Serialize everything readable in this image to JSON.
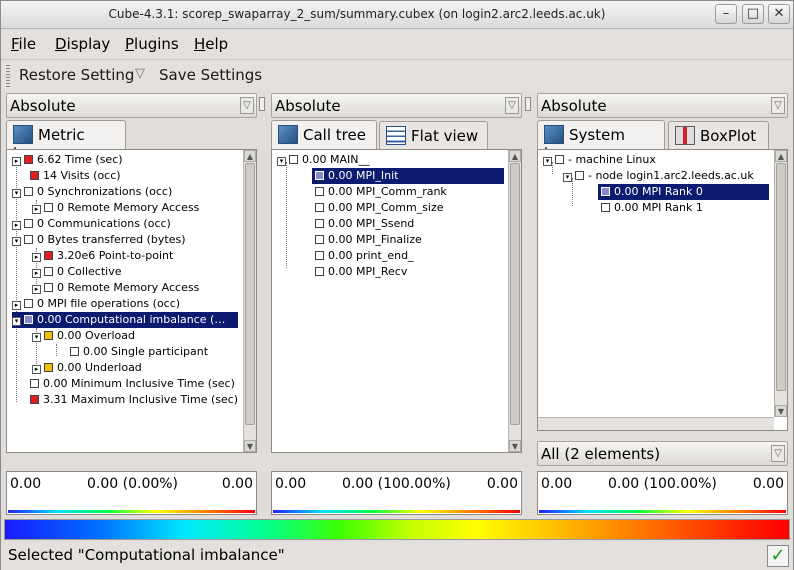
{
  "window": {
    "title": "Cube-4.3.1: scorep_swaparray_2_sum/summary.cubex (on login2.arc2.leeds.ac.uk)",
    "btn_min": "–",
    "btn_max": "□",
    "btn_close": "✕"
  },
  "menu": {
    "file": "F",
    "file_rest": "ile",
    "display": "D",
    "display_rest": "isplay",
    "plugins": "P",
    "plugins_rest": "lugins",
    "help": "H",
    "help_rest": "elp"
  },
  "toolbar": {
    "restore": "Restore Setting",
    "save": "Save Settings"
  },
  "metric_pane": {
    "mode": "Absolute",
    "tab": "Metric tree",
    "rows": [
      {
        "label": "6.62 Time (sec)",
        "color": "#e02020"
      },
      {
        "label": "14 Visits (occ)",
        "color": "#e02020"
      },
      {
        "label": "0 Synchronizations (occ)",
        "color": "#ffffff"
      },
      {
        "label": "0 Remote Memory Access",
        "color": "#ffffff"
      },
      {
        "label": "0 Communications (occ)",
        "color": "#ffffff"
      },
      {
        "label": "0 Bytes transferred (bytes)",
        "color": "#ffffff"
      },
      {
        "label": "3.20e6 Point-to-point",
        "color": "#e02020"
      },
      {
        "label": "0 Collective",
        "color": "#ffffff"
      },
      {
        "label": "0 Remote Memory Access",
        "color": "#ffffff"
      },
      {
        "label": "0 MPI file operations (occ)",
        "color": "#ffffff"
      },
      {
        "label": "0.00 Computational imbalance (…",
        "color": "#8a8ac8"
      },
      {
        "label": "0.00 Overload",
        "color": "#f0c000"
      },
      {
        "label": "0.00 Single participant",
        "color": "#ffffff"
      },
      {
        "label": "0.00 Underload",
        "color": "#f0c000"
      },
      {
        "label": "0.00 Minimum Inclusive Time (sec)",
        "color": "#ffffff"
      },
      {
        "label": "3.31 Maximum Inclusive Time (sec)",
        "color": "#e02020"
      }
    ],
    "value_left": "0.00",
    "value_mid": "0.00 (0.00%)",
    "value_right": "0.00"
  },
  "call_pane": {
    "mode": "Absolute",
    "tab1": "Call tree",
    "tab2": "Flat view",
    "rows": [
      "0.00 MAIN__",
      "0.00 MPI_Init",
      "0.00 MPI_Comm_rank",
      "0.00 MPI_Comm_size",
      "0.00 MPI_Ssend",
      "0.00 MPI_Finalize",
      "0.00 print_end_",
      "0.00 MPI_Recv"
    ],
    "value_left": "0.00",
    "value_mid": "0.00 (100.00%)",
    "value_right": "0.00"
  },
  "system_pane": {
    "mode": "Absolute",
    "tab1": "System tree",
    "tab2": "BoxPlot",
    "rows": [
      "- machine Linux",
      "- node login1.arc2.leeds.ac.uk",
      "0.00 MPI Rank 0",
      "0.00 MPI Rank 1"
    ],
    "selector": "All (2 elements)",
    "value_left": "0.00",
    "value_mid": "0.00 (100.00%)",
    "value_right": "0.00"
  },
  "status": {
    "text": "Selected \"Computational imbalance\"",
    "ok": "✓"
  }
}
